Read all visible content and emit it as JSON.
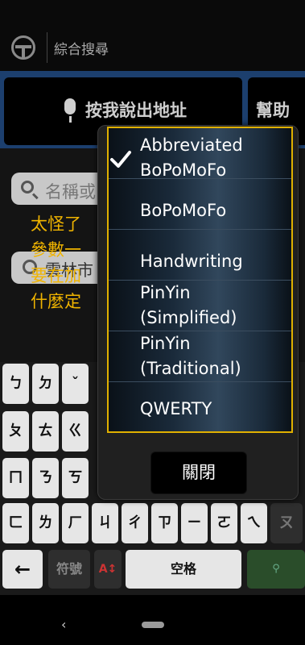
{
  "header": {
    "title": "綜合搜尋",
    "icon": "steering-wheel-icon"
  },
  "voice_bar": {
    "voice_label": "按我說出地址",
    "help_label": "幫助"
  },
  "search": {
    "placeholder": "名稱或",
    "location_text": "雲林市"
  },
  "comment": {
    "lines": [
      "太怪了",
      "參數一",
      "要在加",
      "什麼定"
    ]
  },
  "popup": {
    "items": [
      {
        "label_line1": "Abbreviated",
        "label_line2": "BoPoMoFo",
        "selected": true
      },
      {
        "label_line1": "BoPoMoFo",
        "label_line2": "",
        "selected": false
      },
      {
        "label_line1": "Handwriting",
        "label_line2": "",
        "selected": false
      },
      {
        "label_line1": "PinYin",
        "label_line2": "(Simplified)",
        "selected": false
      },
      {
        "label_line1": "PinYin",
        "label_line2": "(Traditional)",
        "selected": false
      },
      {
        "label_line1": "QWERTY",
        "label_line2": "",
        "selected": false
      }
    ],
    "close_label": "關閉"
  },
  "keyboard": {
    "row1": [
      "ㄅ",
      "ㄉ",
      "ˇ"
    ],
    "row2": [
      "ㄆ",
      "ㄊ",
      "ㄍ"
    ],
    "row3": [
      "ㄇ",
      "ㄋ",
      "ㄎ"
    ],
    "row4": [
      "ㄈ",
      "ㄌ",
      "ㄏ",
      "ㄐ",
      "ㄔ",
      "ㄗ",
      "ㄧ",
      "ㄛ",
      "ㄟ",
      "ㄡ"
    ],
    "symbols_label": "符號",
    "space_label": "空格",
    "backspace_icon": "backspace-arrow-icon",
    "lang_icon": "language-switch-icon",
    "search_icon": "search-icon"
  },
  "navbar": {
    "back_icon": "back-chevron-icon",
    "home_icon": "home-pill-icon"
  }
}
